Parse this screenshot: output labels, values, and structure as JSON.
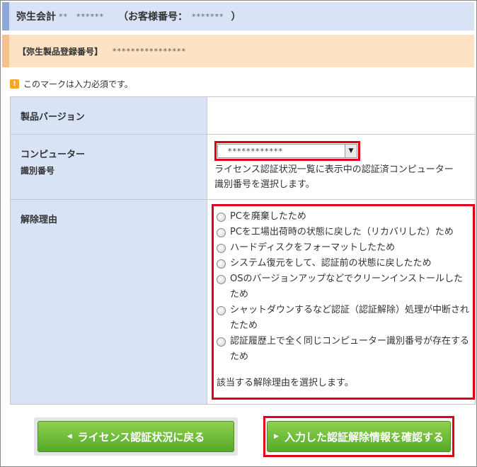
{
  "header": {
    "company_name": "弥生会計",
    "company_mask": "**　******",
    "customer_label": "（お客様番号：",
    "customer_mask": "*******",
    "customer_close": "）"
  },
  "product": {
    "label": "【弥生製品登録番号】",
    "number_mask": "****************"
  },
  "note": {
    "icon": "!",
    "text": "このマークは入力必須です。"
  },
  "form": {
    "version_label": "製品バージョン",
    "version_value": "",
    "computer_label_1": "コンピューター",
    "computer_label_2": "識別番号",
    "computer_select_value": "************",
    "computer_help_1": "ライセンス認証状況一覧に表示中の認証済コンピューター",
    "computer_help_2": "識別番号を選択します。",
    "reason_label": "解除理由",
    "reasons": [
      "PCを廃棄したため",
      "PCを工場出荷時の状態に戻した（リカバリした）ため",
      "ハードディスクをフォーマットしたため",
      "システム復元をして、認証前の状態に戻したため",
      "OSのバージョンアップなどでクリーンインストールしたため",
      "シャットダウンするなど認証（認証解除）処理が中断されたため",
      "認証履歴上で全く同じコンピューター識別番号が存在するため"
    ],
    "reason_help": "該当する解除理由を選択します。"
  },
  "buttons": {
    "back_label": "ライセンス認証状況に戻る",
    "confirm_label": "入力した認証解除情報を確認する"
  },
  "colors": {
    "header_bg": "#d9e3f6",
    "product_bg": "#fde3c4",
    "highlight_red": "#e0001b",
    "button_green": "#6cbf35"
  }
}
